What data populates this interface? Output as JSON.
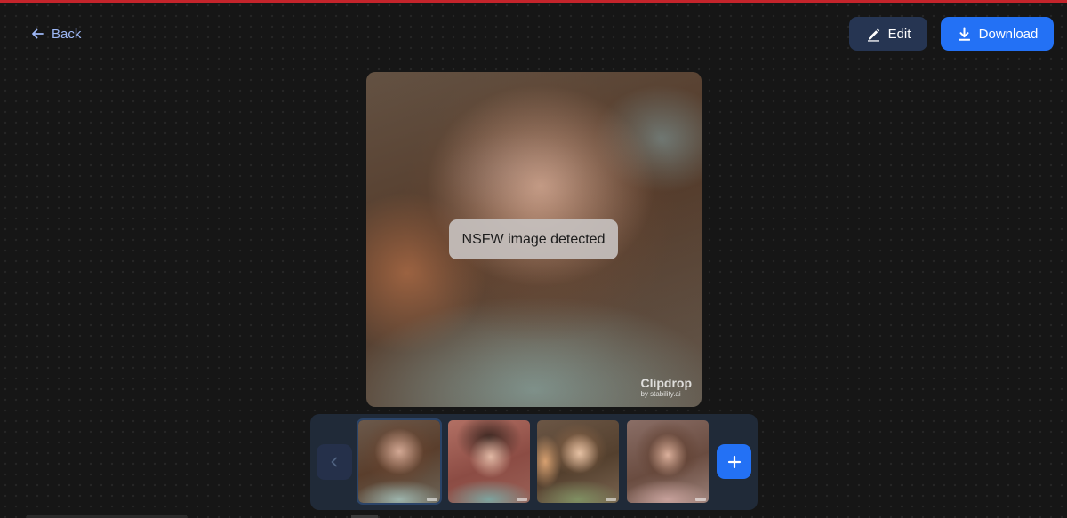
{
  "header": {
    "back_label": "Back",
    "edit_label": "Edit",
    "download_label": "Download",
    "accent_color": "#2371f5",
    "top_bar_color": "#c4242b"
  },
  "preview": {
    "status_text": "NSFW image detected",
    "watermark_brand": "Clipdrop",
    "watermark_sub": "by stability.ai"
  },
  "thumbnails": {
    "items": [
      {
        "selected": true
      },
      {
        "selected": false
      },
      {
        "selected": false
      },
      {
        "selected": false
      }
    ],
    "prev_icon": "chevron-left-icon",
    "add_icon": "plus-icon"
  }
}
